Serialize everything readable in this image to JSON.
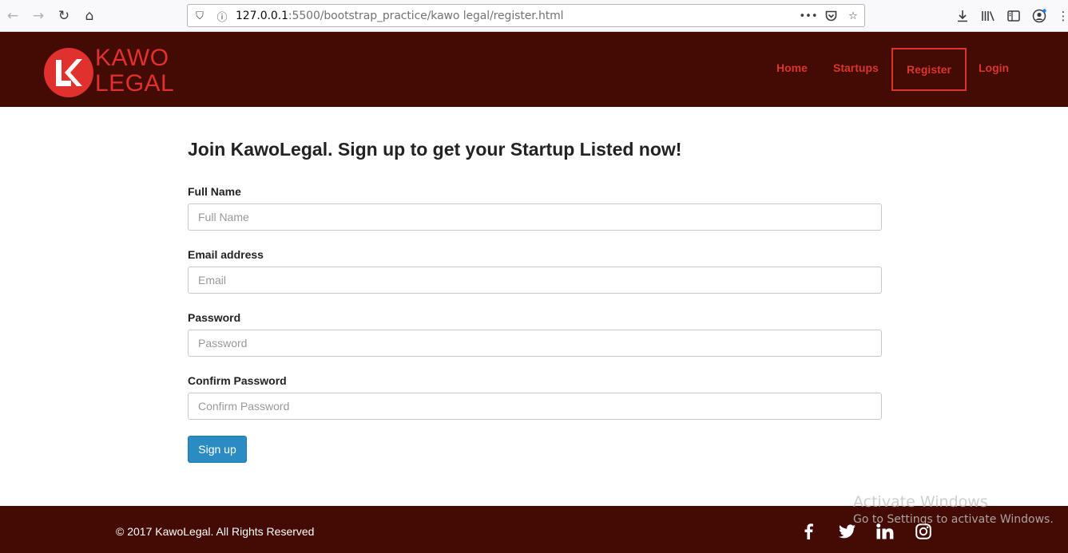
{
  "browser": {
    "url_host": "127.0.0.1",
    "url_rest": ":5500/bootstrap_practice/kawo legal/register.html",
    "icons": [
      "back-icon",
      "forward-icon",
      "reload-icon",
      "home-icon",
      "shield-icon",
      "info-icon",
      "more-icon",
      "pocket-icon",
      "bookmark-star-icon",
      "download-icon",
      "library-icon",
      "sidebar-icon",
      "account-icon",
      "menu-icon"
    ]
  },
  "site": {
    "logo_line1": "KAWO",
    "logo_line2": "LEGAL",
    "logo_mark": "LK",
    "nav": {
      "home": "Home",
      "startups": "Startups",
      "register": "Register",
      "login": "Login"
    }
  },
  "form": {
    "title": "Join KawoLegal. Sign up to get your Startup Listed now!",
    "full_name": {
      "label": "Full Name",
      "placeholder": "Full Name",
      "value": ""
    },
    "email": {
      "label": "Email address",
      "placeholder": "Email",
      "value": ""
    },
    "password": {
      "label": "Password",
      "placeholder": "Password",
      "value": ""
    },
    "confirm": {
      "label": "Confirm Password",
      "placeholder": "Confirm Password",
      "value": ""
    },
    "submit": "Sign up"
  },
  "footer": {
    "copyright": "© 2017 KawoLegal. All Rights Reserved",
    "social": [
      "facebook-icon",
      "twitter-icon",
      "linkedin-icon",
      "instagram-icon"
    ]
  },
  "watermark": {
    "title": "Activate Windows",
    "subtitle": "Go to Settings to activate Windows."
  },
  "colors": {
    "header_bg": "#430b04",
    "accent": "#d9362d",
    "button": "#2a8cc2"
  }
}
